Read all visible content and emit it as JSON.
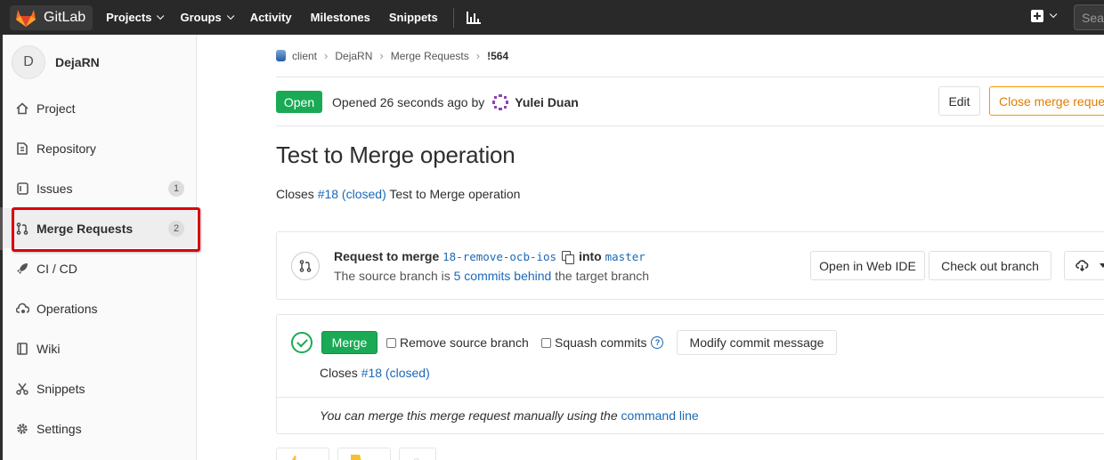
{
  "navbar": {
    "brand": "GitLab",
    "links": [
      {
        "label": "Projects",
        "dropdown": true
      },
      {
        "label": "Groups",
        "dropdown": true
      },
      {
        "label": "Activity",
        "dropdown": false
      },
      {
        "label": "Milestones",
        "dropdown": false
      },
      {
        "label": "Snippets",
        "dropdown": false
      }
    ],
    "search_placeholder": "Sea"
  },
  "sidebar": {
    "project_initial": "D",
    "project_name": "DejaRN",
    "items": [
      {
        "label": "Project",
        "icon": "home-icon"
      },
      {
        "label": "Repository",
        "icon": "doc-icon"
      },
      {
        "label": "Issues",
        "icon": "issues-icon",
        "count": "1"
      },
      {
        "label": "Merge Requests",
        "icon": "merge-request-icon",
        "count": "2",
        "active": true
      },
      {
        "label": "CI / CD",
        "icon": "rocket-icon"
      },
      {
        "label": "Operations",
        "icon": "cloud-gear-icon"
      },
      {
        "label": "Wiki",
        "icon": "book-icon"
      },
      {
        "label": "Snippets",
        "icon": "scissors-icon"
      },
      {
        "label": "Settings",
        "icon": "gear-icon"
      }
    ]
  },
  "breadcrumb": [
    "client",
    "DejaRN",
    "Merge Requests",
    "!564"
  ],
  "mr": {
    "status": "Open",
    "opened_text": "Opened 26 seconds ago by",
    "author": "Yulei Duan",
    "edit_label": "Edit",
    "close_label": "Close merge request",
    "title": "Test to Merge operation",
    "closes_prefix": "Closes",
    "issue_ref": "#18 (closed)",
    "closes_suffix": "Test to Merge operation"
  },
  "widget": {
    "request_to_merge": "Request to merge",
    "source_branch": "18-remove-ocb-ios",
    "into": "into",
    "target_branch": "master",
    "behind_prefix": "The source branch is",
    "behind_link": "5 commits behind",
    "behind_suffix": "the target branch",
    "open_web_ide": "Open in Web IDE",
    "check_out_branch": "Check out branch"
  },
  "merge": {
    "merge_label": "Merge",
    "remove_source_branch": "Remove source branch",
    "squash_commits": "Squash commits",
    "modify_commit_message": "Modify commit message",
    "closes_prefix": "Closes",
    "issue_ref": "#18 (closed)",
    "manual_text": "You can merge this merge request manually using the",
    "command_line": "command line"
  },
  "colors": {
    "accent_green": "#1aaa55",
    "link_blue": "#1b69b6",
    "warning_orange": "#fc9403",
    "highlight_red": "#d9000d"
  }
}
